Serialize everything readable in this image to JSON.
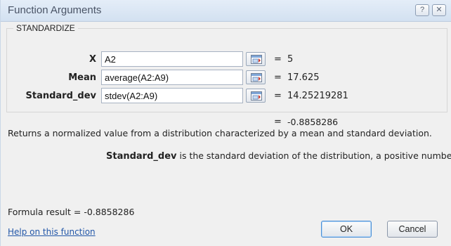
{
  "dialog": {
    "title": "Function Arguments",
    "help_button": "?",
    "close_button": "✕"
  },
  "function_name": "STANDARDIZE",
  "arguments": [
    {
      "label": "X",
      "value": "A2",
      "evaluated": "5"
    },
    {
      "label": "Mean",
      "value": "average(A2:A9)",
      "evaluated": "17.625"
    },
    {
      "label": "Standard_dev",
      "value": "stdev(A2:A9)",
      "evaluated": "14.25219281"
    }
  ],
  "equals": "=",
  "function_result": "-0.8858286",
  "description": "Returns a normalized value from a distribution characterized by a mean and standard deviation.",
  "argument_help": {
    "name": "Standard_dev",
    "text": "is the standard deviation of the distribution, a positive number."
  },
  "formula_result": {
    "label": "Formula result =",
    "value": "-0.8858286"
  },
  "help_link": "Help on this function",
  "buttons": {
    "ok": "OK",
    "cancel": "Cancel"
  }
}
